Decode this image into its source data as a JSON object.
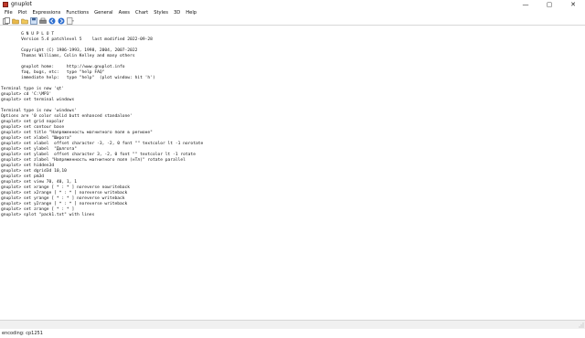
{
  "window": {
    "title": "gnuplot",
    "minimize_glyph": "—",
    "maximize_glyph": "▢",
    "close_glyph": "✕"
  },
  "menu": [
    "File",
    "Plot",
    "Expressions",
    "Functions",
    "General",
    "Axes",
    "Chart",
    "Styles",
    "3D",
    "Help"
  ],
  "toolbar": {
    "icons": [
      "copy-icon",
      "open-icon",
      "save-icon",
      "chdir-icon",
      "print-icon",
      "prev-icon",
      "next-icon",
      "options-icon"
    ]
  },
  "console_lines": [
    "",
    "        G N U P L O T",
    "        Version 5.4 patchlevel 5    last modified 2022-09-28",
    "",
    "        Copyright (C) 1986-1993, 1998, 2004, 2007-2022",
    "        Thomas Williams, Colin Kelley and many others",
    "",
    "        gnuplot home:     http://www.gnuplot.info",
    "        faq, bugs, etc:   type \"help FAQ\"",
    "        immediate help:   type \"help\"  (plot window: hit 'h')",
    "",
    "Terminal type is now 'qt'",
    "gnuplot> cd 'C:\\MP3'",
    "gnuplot> set terminal windows",
    "",
    "Terminal type is now 'windows'",
    "Options are '0 color solid butt enhanced standalone'",
    "gnuplot> set grid nopolar",
    "gnuplot> set contour base",
    "gnuplot> set title \"Напряженность магнитного поля в регионе\"",
    "gnuplot> set xlabel \"Широта\"",
    "gnuplot> set xlabel  offset character -3, -2, 0 font \"\" textcolor lt -1 norotate",
    "gnuplot> set ylabel  \"Долгота\"",
    "gnuplot> set ylabel  offset character 3, -2, 0 font \"\" textcolor lt -1 rotate",
    "gnuplot> set zlabel \"Напряженность магнитного поля (нТл)\" rotate parallel",
    "gnuplot> set hidden3d",
    "gnuplot> set dgrid3d 10,10",
    "gnuplot> set pm3d",
    "gnuplot> set view 70, 40, 1, 1",
    "gnuplot> set xrange [ * : * ] noreverse nowriteback",
    "gnuplot> set x2range [ * : * ] noreverse writeback",
    "gnuplot> set yrange [ * : * ] noreverse writeback",
    "gnuplot> set y2range [ * : * ] noreverse writeback",
    "gnuplot> set zrange [ * : * ]",
    "gnuplot> splot \"pack1.txt\" with lines"
  ],
  "status": {
    "encoding": "encoding: cp1251"
  }
}
